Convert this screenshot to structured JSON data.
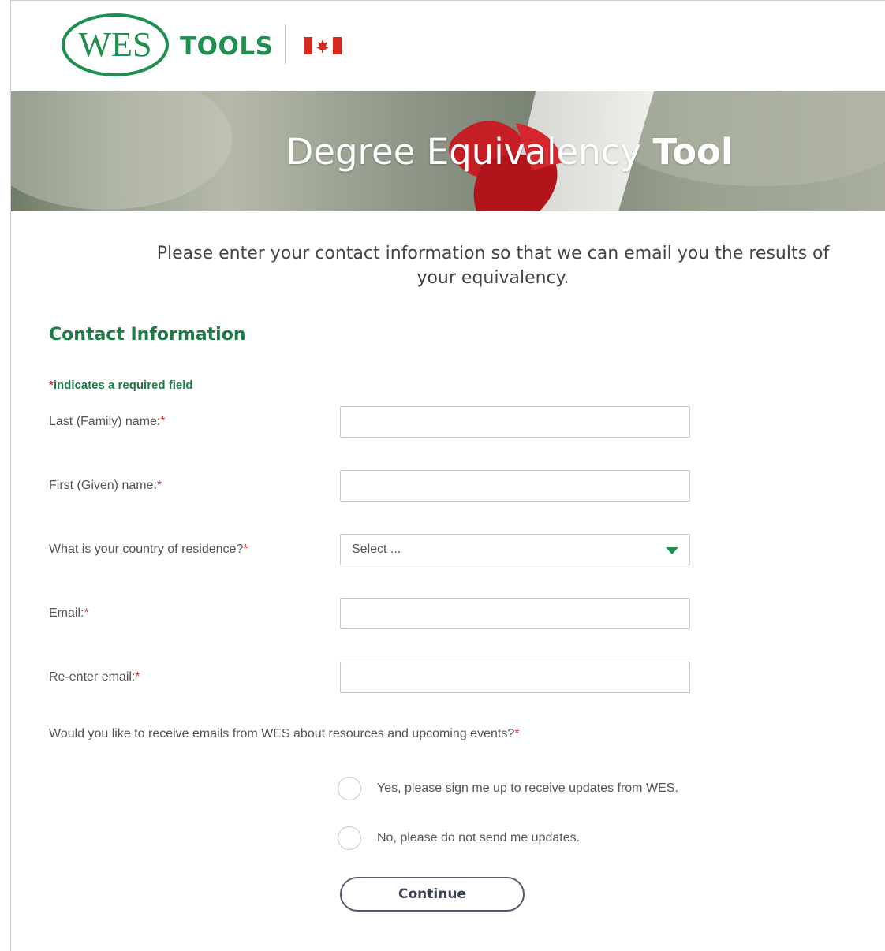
{
  "header": {
    "logo_text": "WES",
    "tools_label": "TOOLS"
  },
  "banner": {
    "title_light": "Degree Equivalency",
    "title_bold": "Tool"
  },
  "intro": "Please enter your contact information so that we can email you the results of your equivalency.",
  "section_title": "Contact Information",
  "required_note": {
    "star": "*",
    "text": "indicates a required field"
  },
  "form": {
    "last_name_label": "Last (Family) name:",
    "first_name_label": "First (Given) name:",
    "country_label": "What is your country of residence?",
    "country_value": "Select ...",
    "email_label": "Email:",
    "reenter_email_label": "Re-enter email:",
    "required_star": "*",
    "last_name_value": "",
    "first_name_value": "",
    "email_value": "",
    "reenter_email_value": ""
  },
  "newsletter": {
    "question": "Would you like to receive emails from WES about resources and upcoming events?",
    "options": [
      "Yes, please sign me up to receive updates from WES.",
      "No, please do not send me updates."
    ]
  },
  "continue_label": "Continue",
  "colors": {
    "brand_green": "#1e8f4f",
    "required_red": "#d23b3b",
    "button_border": "#505a6b"
  }
}
